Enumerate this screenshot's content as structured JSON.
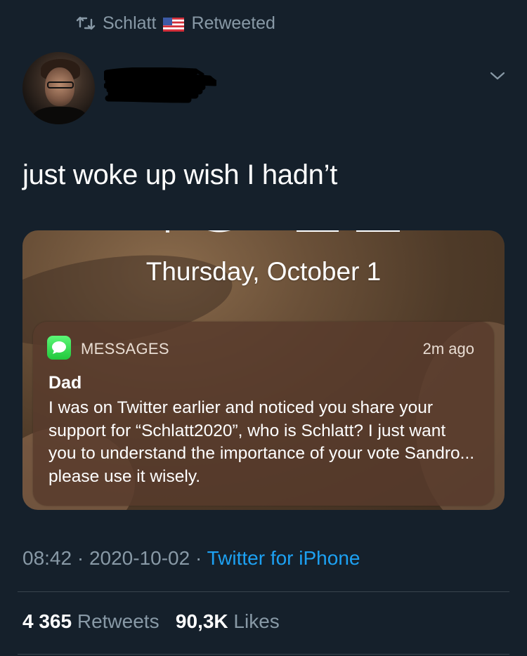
{
  "retweet_banner": {
    "user": "Schlatt",
    "flag_icon": "us-flag-icon",
    "label": "Retweeted"
  },
  "tweet": {
    "text": "just woke up wish I hadn’t"
  },
  "media": {
    "lock_screen_date": "Thursday, October 1",
    "notification": {
      "app": "MESSAGES",
      "time": "2m ago",
      "sender": "Dad",
      "body": "I was on Twitter earlier and noticed you share your support for “Schlatt2020”, who is Schlatt? I just want you to understand the importance of your vote Sandro... please use it wisely."
    }
  },
  "meta": {
    "time": "08:42",
    "sep1": " · ",
    "date": "2020-10-02",
    "sep2": " · ",
    "source": "Twitter for iPhone"
  },
  "stats": {
    "retweets_count": "4 365",
    "retweets_label": "Retweets",
    "likes_count": "90,3K",
    "likes_label": "Likes"
  },
  "colors": {
    "background": "#15202b",
    "secondary_text": "#8899a6",
    "link_blue": "#1da1f2",
    "divider": "#38444d"
  }
}
